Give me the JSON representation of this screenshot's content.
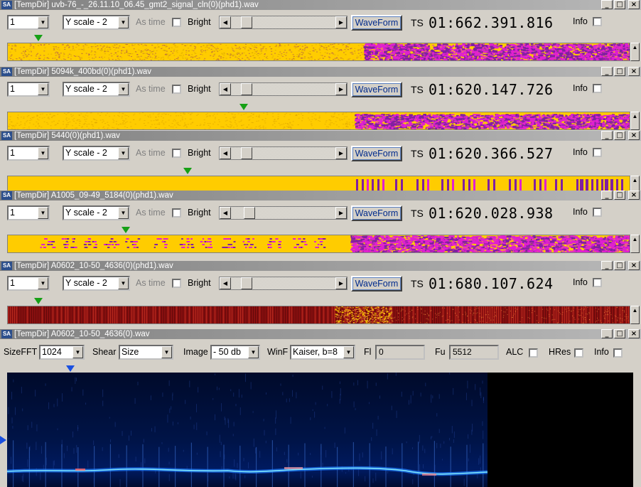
{
  "windows": [
    {
      "title": "[TempDir] uvb-76_-_26.11.10_06.45_gmt2_signal_cln(0)(phd1).wav",
      "channel": "1",
      "yscale": "Y scale - 2",
      "as_time_label": "As time",
      "bright_label": "Bright",
      "waveform_label": "WaveForm",
      "ts_label": "TS",
      "ts_value": "01:662.391.816",
      "info_label": "Info",
      "marker_position_fraction": 0.05,
      "strip_pattern": "dense-magenta-noise"
    },
    {
      "title": "[TempDir] 5094k_400bd(0)(phd1).wav",
      "channel": "1",
      "yscale": "Y scale - 2",
      "as_time_label": "As time",
      "bright_label": "Bright",
      "waveform_label": "WaveForm",
      "ts_label": "TS",
      "ts_value": "01:620.147.726",
      "info_label": "Info",
      "marker_position_fraction": 0.38,
      "strip_pattern": "magenta-noise"
    },
    {
      "title": "[TempDir] 5440(0)(phd1).wav",
      "channel": "1",
      "yscale": "Y scale - 2",
      "as_time_label": "As time",
      "bright_label": "Bright",
      "waveform_label": "WaveForm",
      "ts_label": "TS",
      "ts_value": "01:620.366.527",
      "info_label": "Info",
      "marker_position_fraction": 0.29,
      "strip_pattern": "bars"
    },
    {
      "title": "[TempDir] A1005_09-49_5184(0)(phd1).wav",
      "channel": "1",
      "yscale": "Y scale - 2",
      "as_time_label": "As time",
      "bright_label": "Bright",
      "waveform_label": "WaveForm",
      "ts_label": "TS",
      "ts_value": "01:620.028.938",
      "info_label": "Info",
      "marker_position_fraction": 0.19,
      "strip_pattern": "blocks"
    },
    {
      "title": "[TempDir] A0602_10-50_4636(0)(phd1).wav",
      "channel": "1",
      "yscale": "Y scale - 2",
      "as_time_label": "As time",
      "bright_label": "Bright",
      "waveform_label": "WaveForm",
      "ts_label": "TS",
      "ts_value": "01:680.107.624",
      "info_label": "Info",
      "marker_position_fraction": 0.05,
      "strip_pattern": "red-lines"
    }
  ],
  "spectrum": {
    "title": "[TempDir] A0602_10-50_4636(0).wav",
    "sizefft_label": "SizeFFT",
    "sizefft_value": "1024",
    "shear_label": "Shear",
    "shear_value": "Size",
    "image_label": "Image",
    "image_value": "- 50 db",
    "winf_label": "WinF",
    "winf_value": "Kaiser, b=8",
    "fl_label": "Fl",
    "fl_value": "0",
    "fu_label": "Fu",
    "fu_value": "5512",
    "alc_label": "ALC",
    "hres_label": "HRes",
    "info_label": "Info"
  },
  "colors": {
    "strip_yellow": "#ffcc00",
    "strip_magenta": "#e020d0",
    "strip_purple": "#8020a0",
    "marker_green": "#16a016",
    "marker_blue": "#1a50e0",
    "waveform_text": "#002a8c"
  },
  "icons": {
    "app": "sa-app-icon",
    "minimize": "minimize-icon",
    "maximize": "maximize-icon",
    "close": "close-icon"
  }
}
